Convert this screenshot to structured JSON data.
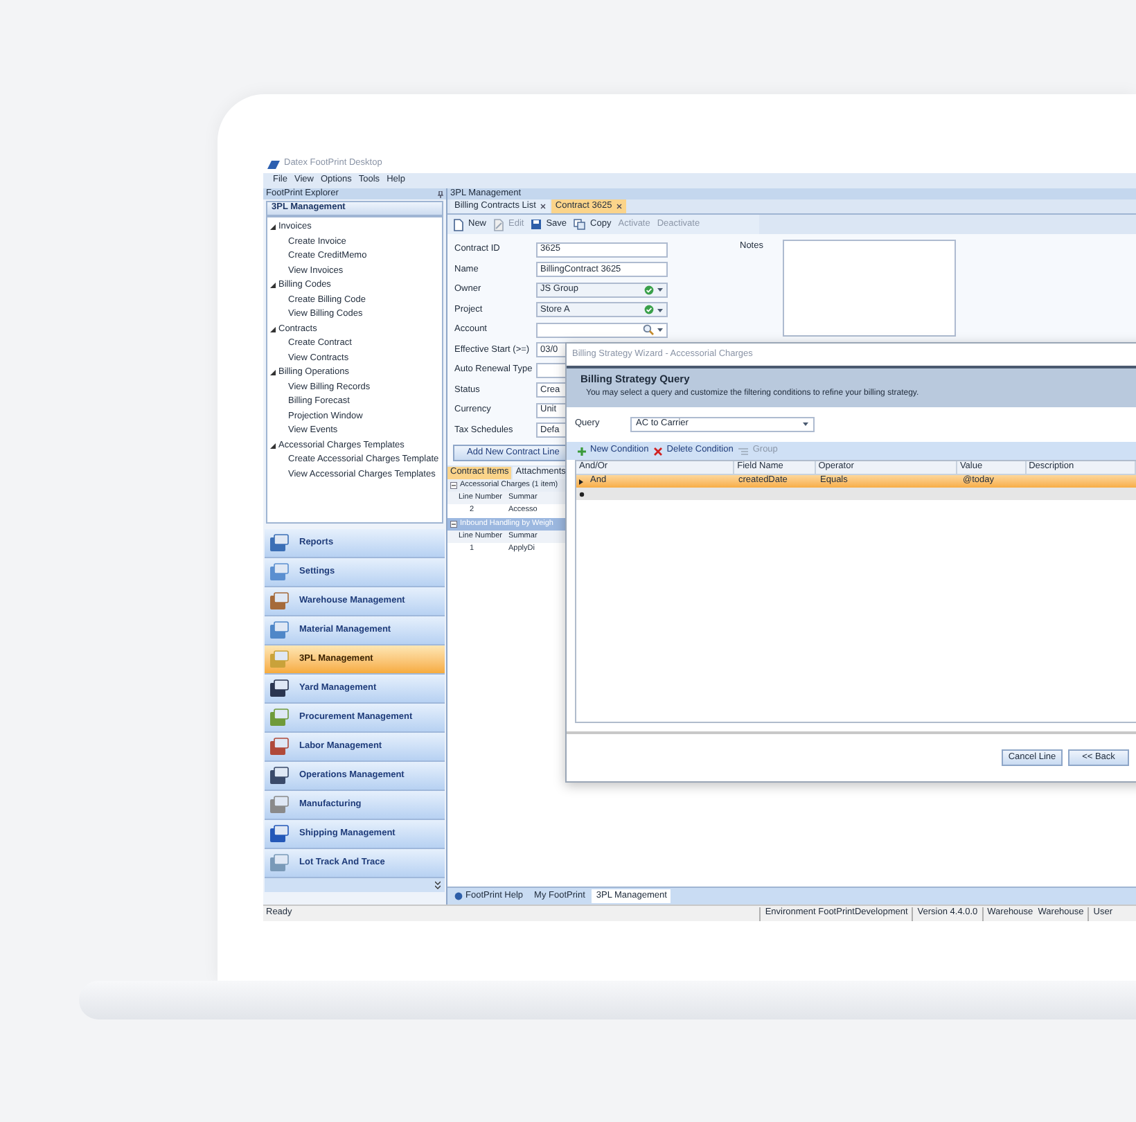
{
  "app": {
    "title": "Datex FootPrint Desktop",
    "menu": [
      "File",
      "View",
      "Options",
      "Tools",
      "Help"
    ]
  },
  "explorer": {
    "title": "FootPrint Explorer",
    "section": "3PL Management",
    "tree": [
      {
        "label": "Invoices",
        "expanded": true,
        "children": [
          {
            "label": "Create Invoice"
          },
          {
            "label": "Create CreditMemo"
          },
          {
            "label": "View Invoices"
          }
        ]
      },
      {
        "label": "Billing Codes",
        "expanded": true,
        "children": [
          {
            "label": "Create Billing Code"
          },
          {
            "label": "View Billing Codes"
          }
        ]
      },
      {
        "label": "Contracts",
        "expanded": true,
        "children": [
          {
            "label": "Create Contract"
          },
          {
            "label": "View Contracts"
          }
        ]
      },
      {
        "label": "Billing Operations",
        "expanded": true,
        "children": [
          {
            "label": "View Billing Records"
          },
          {
            "label": "Billing Forecast"
          },
          {
            "label": "Projection Window"
          },
          {
            "label": "View Events"
          }
        ]
      },
      {
        "label": "Accessorial Charges Templates",
        "expanded": true,
        "children": [
          {
            "label": "Create Accessorial Charges Template"
          },
          {
            "label": "View Accessorial Charges Templates"
          }
        ]
      }
    ],
    "modules": [
      {
        "label": "Reports",
        "selected": false
      },
      {
        "label": "Settings",
        "selected": false
      },
      {
        "label": "Warehouse Management",
        "selected": false
      },
      {
        "label": "Material Management",
        "selected": false
      },
      {
        "label": "3PL Management",
        "selected": true
      },
      {
        "label": "Yard Management",
        "selected": false
      },
      {
        "label": "Procurement Management",
        "selected": false
      },
      {
        "label": "Labor Management",
        "selected": false
      },
      {
        "label": "Operations Management",
        "selected": false
      },
      {
        "label": "Manufacturing",
        "selected": false
      },
      {
        "label": "Shipping Management",
        "selected": false
      },
      {
        "label": "Lot Track And Trace",
        "selected": false
      }
    ]
  },
  "workspace": {
    "title": "3PL Management",
    "tabs": [
      {
        "label": "Billing Contracts List",
        "selected": false
      },
      {
        "label": "Contract 3625",
        "selected": true
      }
    ],
    "toolbar": [
      {
        "label": "New",
        "disabled": false
      },
      {
        "label": "Edit",
        "disabled": true
      },
      {
        "label": "Save",
        "disabled": false
      },
      {
        "label": "Copy",
        "disabled": false
      },
      {
        "label": "Activate",
        "disabled": true
      },
      {
        "label": "Deactivate",
        "disabled": true
      }
    ],
    "fields": [
      {
        "label": "Contract ID",
        "value": "3625",
        "kind": "text"
      },
      {
        "label": "Name",
        "value": "BillingContract 3625",
        "kind": "text"
      },
      {
        "label": "Owner",
        "value": "JS Group",
        "kind": "lookup"
      },
      {
        "label": "Project",
        "value": "Store A",
        "kind": "lookup"
      },
      {
        "label": "Account",
        "kind": "search"
      },
      {
        "label": "Effective Start (>=)",
        "value": "03/0",
        "kind": "text"
      },
      {
        "label": "Auto Renewal Type",
        "kind": "text"
      },
      {
        "label": "Status",
        "value": "Crea",
        "kind": "text"
      },
      {
        "label": "Currency",
        "value": "Unit",
        "kind": "text"
      },
      {
        "label": "Tax Schedules",
        "value": "Defa",
        "kind": "text"
      }
    ],
    "notes_label": "Notes",
    "add_line_button": "Add New Contract Line",
    "detail_tabs": [
      {
        "label": "Contract Items",
        "selected": true
      },
      {
        "label": "Attachments",
        "selected": false
      }
    ],
    "groups": [
      {
        "title": "Accessorial Charges (1 item)",
        "selected": false,
        "columns": [
          "Line Number",
          "Summar"
        ],
        "rows": [
          [
            "2",
            "Accesso"
          ]
        ]
      },
      {
        "title": "Inbound Handling by Weigh",
        "selected": true,
        "columns": [
          "Line Number",
          "Summar"
        ],
        "rows": [
          [
            "1",
            "ApplyDi"
          ]
        ]
      }
    ],
    "bottom_tabs": [
      {
        "label": "FootPrint Help",
        "selected": false
      },
      {
        "label": "My FootPrint",
        "selected": false
      },
      {
        "label": "3PL Management",
        "selected": true
      }
    ]
  },
  "dialog": {
    "title": "Billing Strategy Wizard - Accessorial Charges",
    "heading": "Billing Strategy Query",
    "description": "You may select a query and customize the filtering conditions to refine your billing strategy.",
    "query_label": "Query",
    "query_value": "AC to Carrier",
    "toolbar": [
      {
        "label": "New Condition",
        "disabled": false
      },
      {
        "label": "Delete Condition",
        "disabled": false
      },
      {
        "label": "Group",
        "disabled": true
      }
    ],
    "columns": [
      "And/Or",
      "Field Name",
      "Operator",
      "Value",
      "Description"
    ],
    "conditions": [
      {
        "and_or": "And",
        "field": "createdDate",
        "operator": "Equals",
        "value": "@today",
        "selected": true
      }
    ],
    "buttons": [
      "Cancel Line",
      "<< Back"
    ]
  },
  "status_bar": {
    "status": "Ready",
    "items": [
      "Environment FootPrintDevelopment",
      "Version 4.4.0.0",
      "Warehouse  Warehouse",
      "User"
    ]
  }
}
